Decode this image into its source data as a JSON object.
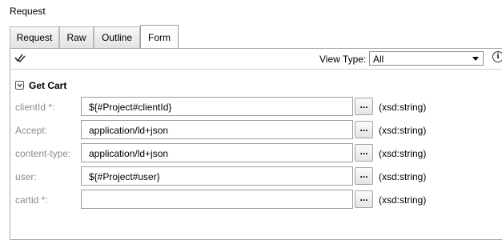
{
  "panel": {
    "title": "Request"
  },
  "tabs": [
    {
      "label": "Request",
      "active": false
    },
    {
      "label": "Raw",
      "active": false
    },
    {
      "label": "Outline",
      "active": false
    },
    {
      "label": "Form",
      "active": true
    }
  ],
  "toolbar": {
    "icon": "double-check-icon",
    "view_type_label": "View Type:",
    "view_type_value": "All",
    "info_icon_glyph": "i"
  },
  "section": {
    "title": "Get Cart",
    "expanded": true
  },
  "params": [
    {
      "label": "clientId *:",
      "value": "${#Project#clientId}",
      "button": "...",
      "type": "(xsd:string)"
    },
    {
      "label": "Accept:",
      "value": "application/ld+json",
      "button": "...",
      "type": "(xsd:string)"
    },
    {
      "label": "content-type:",
      "value": "application/ld+json",
      "button": "...",
      "type": "(xsd:string)"
    },
    {
      "label": "user:",
      "value": "${#Project#user}",
      "button": "...",
      "type": "(xsd:string)"
    },
    {
      "label": "cartid *:",
      "value": "",
      "button": "...",
      "type": "(xsd:string)"
    }
  ]
}
